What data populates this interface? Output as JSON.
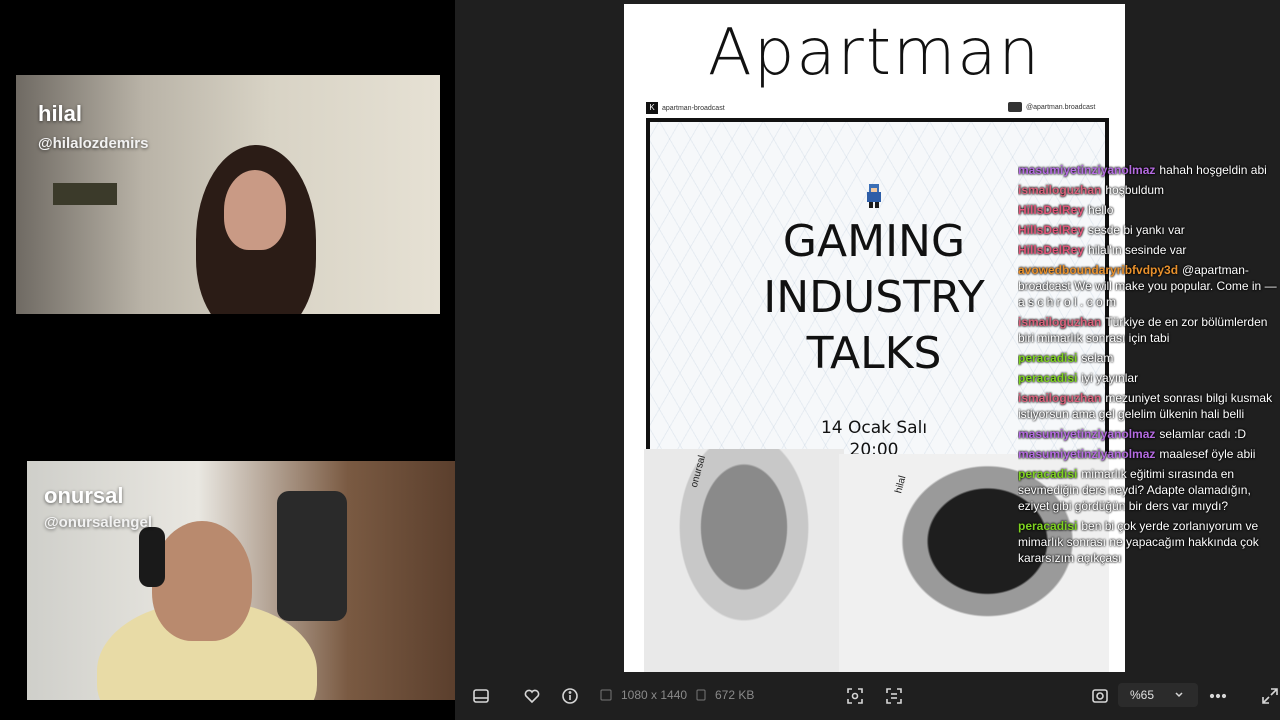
{
  "cameras": {
    "hilal": {
      "name": "hilal",
      "handle": "@hilalozdemirs"
    },
    "onursal": {
      "name": "onursal",
      "handle": "@onursalengel"
    }
  },
  "poster": {
    "logo": "Apartman",
    "brand_left": "apartman-broadcast",
    "brand_right": "@apartman.broadcast",
    "title_lines": [
      "GAMING",
      "INDUSTRY",
      "TALKS"
    ],
    "date": "14 Ocak Salı",
    "time": "20:00",
    "label_onursal": "onursal",
    "label_hilal": "hilal"
  },
  "chat": [
    {
      "user": "masumiyetinziyanolmaz",
      "color": "#b46be0",
      "text": "hahah hoşgeldin abi"
    },
    {
      "user": "ismailoguzhan",
      "color": "#d9627c",
      "text": "hoşbuldum"
    },
    {
      "user": "HillsDelRey",
      "color": "#e0577a",
      "text": "hello"
    },
    {
      "user": "HillsDelRey",
      "color": "#e0577a",
      "text": "sesde bi yankı var"
    },
    {
      "user": "HillsDelRey",
      "color": "#e0577a",
      "text": "hilal'ın sesinde var"
    },
    {
      "user": "avowedboundaryribfvdpy3d",
      "color": "#e8912d",
      "text": "@apartman-broadcast We will make you popular. Come in — a s c h r o l . c o m"
    },
    {
      "user": "ismailoguzhan",
      "color": "#d9627c",
      "text": "Türkiye de en zor bölümlerden biri mimarlık sonrası için tabi"
    },
    {
      "user": "peracadisi",
      "color": "#7ed321",
      "text": "selam"
    },
    {
      "user": "peracadisi",
      "color": "#7ed321",
      "text": "iyi yayınlar"
    },
    {
      "user": "ismailoguzhan",
      "color": "#d9627c",
      "text": "mezuniyet sonrası bilgi kusmak istiyorsun ama gel gelelim ülkenin hali belli"
    },
    {
      "user": "masumiyetinziyanolmaz",
      "color": "#b46be0",
      "text": "selamlar cadı :D"
    },
    {
      "user": "masumiyetinziyanolmaz",
      "color": "#b46be0",
      "text": "maalesef öyle abii"
    },
    {
      "user": "peracadisi",
      "color": "#7ed321",
      "text": "mimarlık eğitimi sırasında en sevmediğin ders neydi? Adapte olamadığın, eziyet gibi gördüğün bir ders var mıydı?"
    },
    {
      "user": "peracadisi",
      "color": "#7ed321",
      "text": "ben bi çok yerde zorlanıyorum ve mimarlık sonrası ne yapacağım hakkında çok kararsızım açıkçası"
    }
  ],
  "toolbar": {
    "dimensions": "1080 x 1440",
    "filesize": "672 KB",
    "zoom": "%65"
  }
}
